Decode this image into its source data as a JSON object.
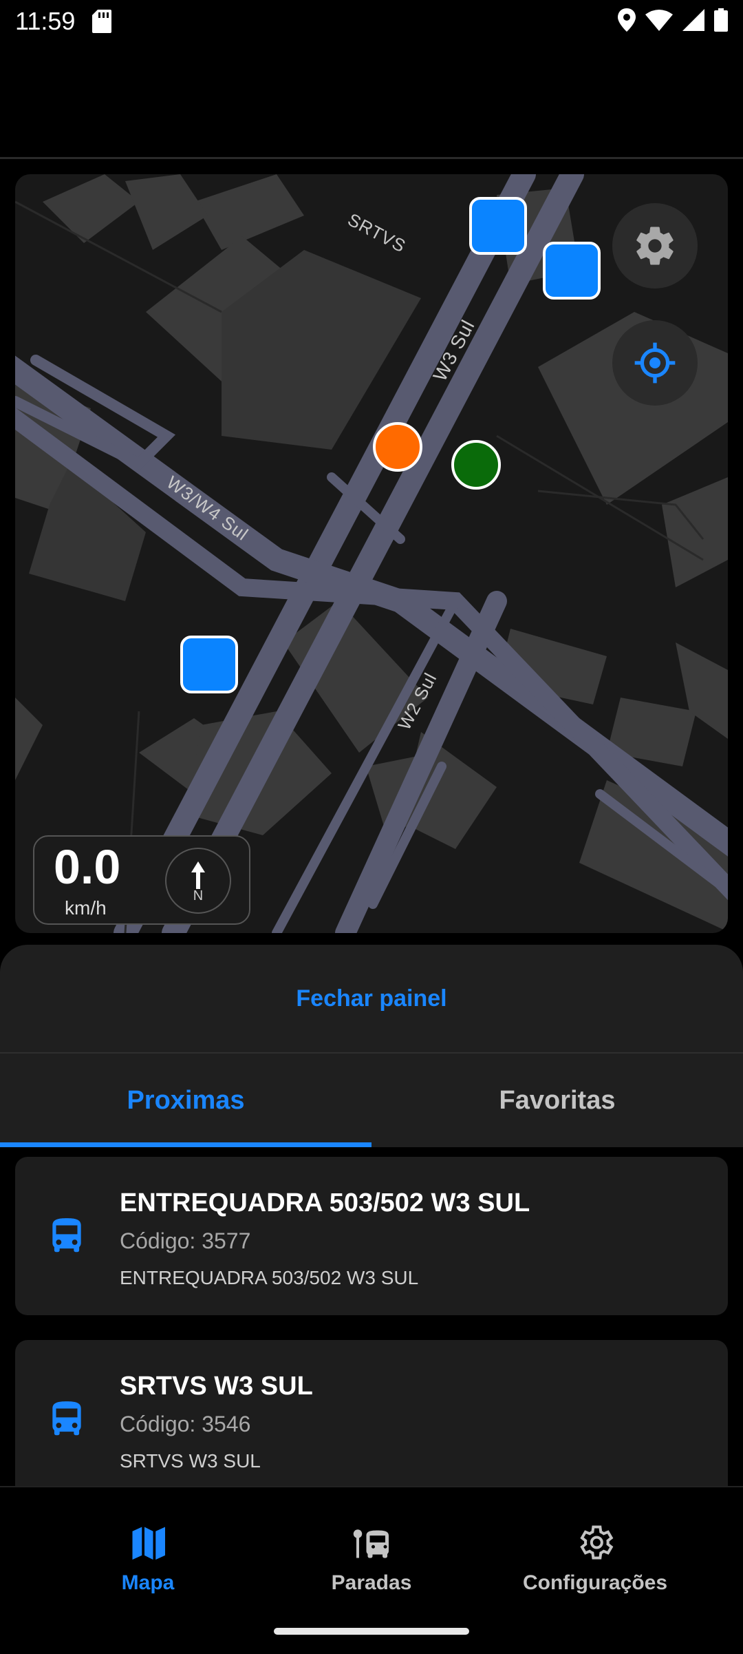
{
  "status_bar": {
    "time": "11:59"
  },
  "map": {
    "road_labels": [
      "SRTVS",
      "W3 Sul",
      "W3/W4 Sul",
      "W2 Sul"
    ],
    "speed": {
      "value": "0.0",
      "unit": "km/h"
    },
    "compass_letter": "N",
    "icons": {
      "settings": "gear-icon",
      "locate": "crosshair-icon"
    },
    "colors": {
      "bus_marker": "#0a84ff",
      "orange_marker": "#ff6a00",
      "green_marker": "#0a6b0a"
    }
  },
  "panel": {
    "close_label": "Fechar painel",
    "tabs": [
      {
        "label": "Proximas",
        "active": true
      },
      {
        "label": "Favoritas",
        "active": false
      }
    ],
    "stops": [
      {
        "name": "ENTREQUADRA 503/502 W3 SUL",
        "code": "Código: 3577",
        "description": "ENTREQUADRA 503/502 W3 SUL"
      },
      {
        "name": "SRTVS W3 SUL",
        "code": "Código: 3546",
        "description": "SRTVS W3 SUL"
      }
    ]
  },
  "bottom_nav": [
    {
      "label": "Mapa",
      "icon": "map-icon",
      "active": true
    },
    {
      "label": "Paradas",
      "icon": "bus-stop-icon",
      "active": false
    },
    {
      "label": "Configurações",
      "icon": "gear-icon",
      "active": false
    }
  ],
  "accent_color": "#1a86ff"
}
